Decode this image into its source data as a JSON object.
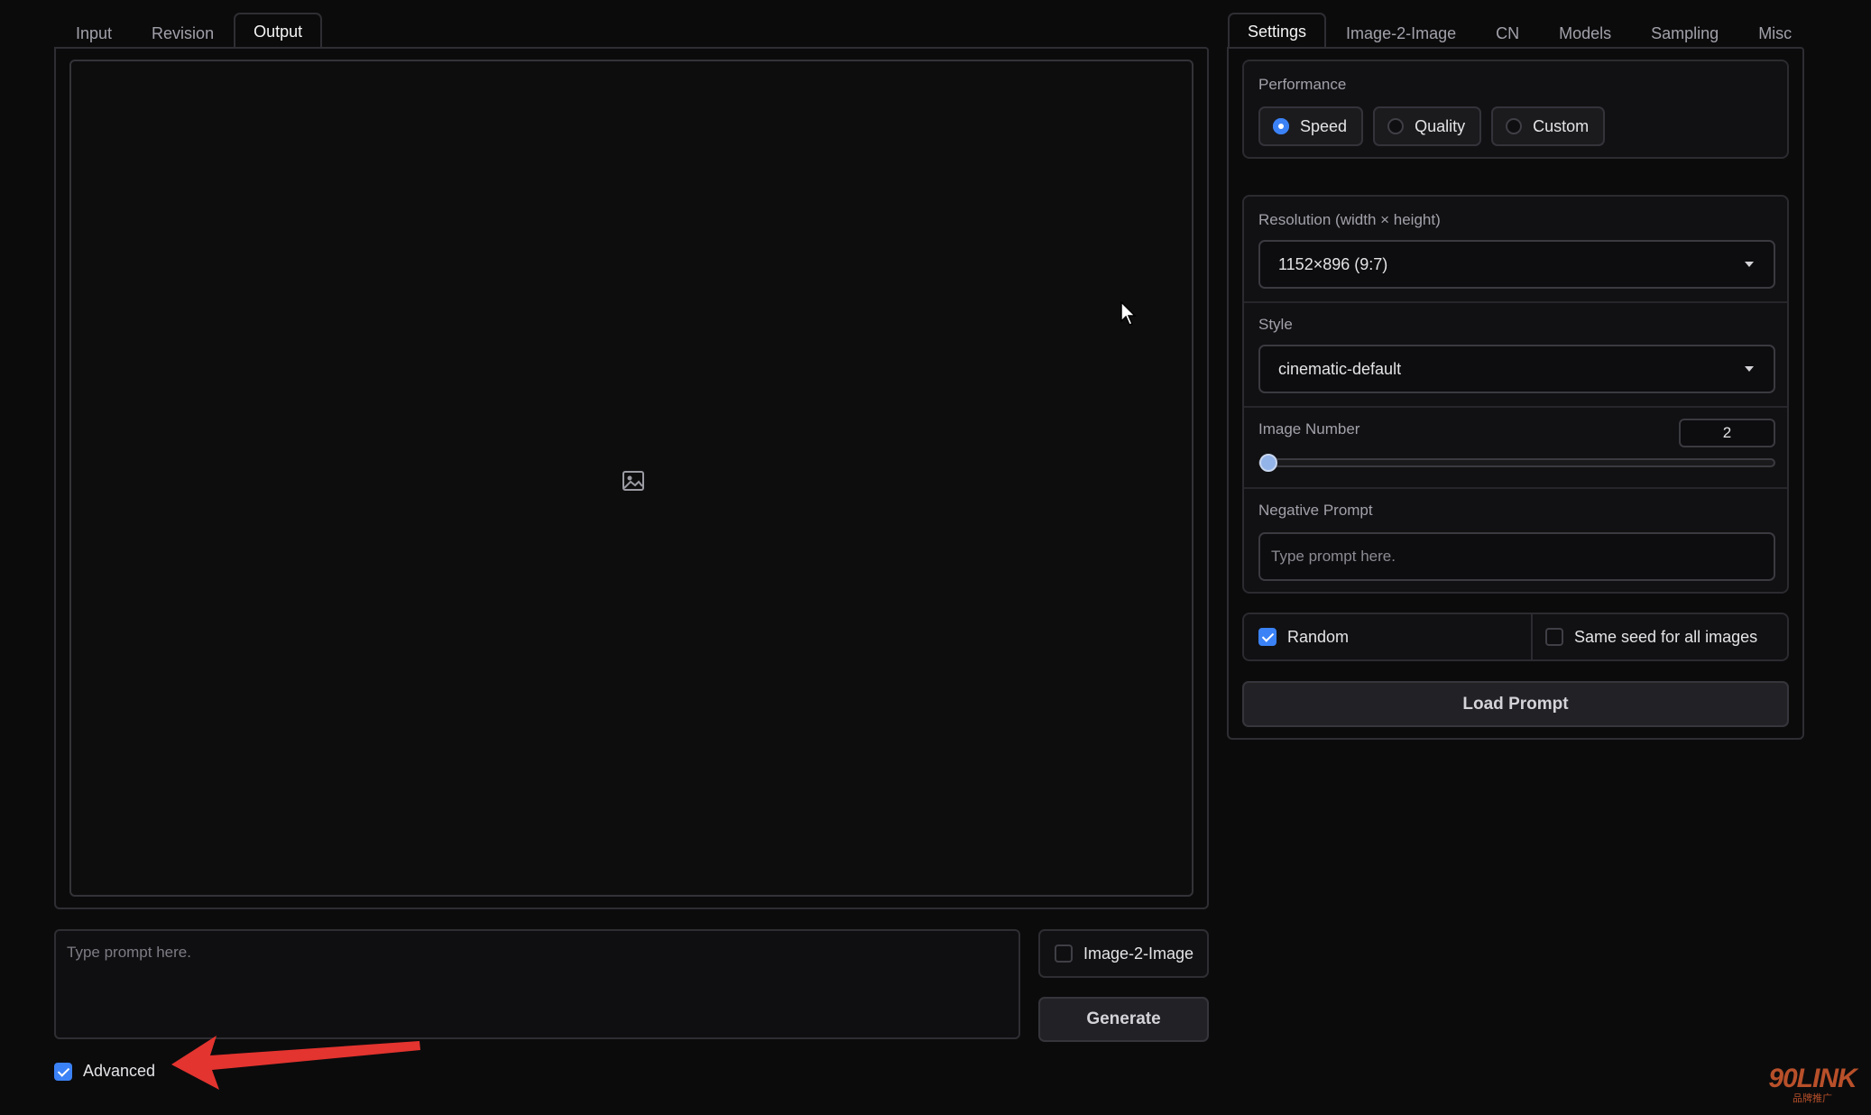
{
  "left_tabs": [
    {
      "label": "Input",
      "active": false
    },
    {
      "label": "Revision",
      "active": false
    },
    {
      "label": "Output",
      "active": true
    }
  ],
  "output": {
    "image_icon": "image-placeholder-icon"
  },
  "prompt": {
    "placeholder": "Type prompt here."
  },
  "image2image_toggle": {
    "label": "Image-2-Image",
    "checked": false
  },
  "generate_button": {
    "label": "Generate"
  },
  "advanced_toggle": {
    "label": "Advanced",
    "checked": true
  },
  "right_tabs": [
    {
      "label": "Settings",
      "active": true
    },
    {
      "label": "Image-2-Image",
      "active": false
    },
    {
      "label": "CN",
      "active": false
    },
    {
      "label": "Models",
      "active": false
    },
    {
      "label": "Sampling",
      "active": false
    },
    {
      "label": "Misc",
      "active": false
    }
  ],
  "settings": {
    "performance": {
      "label": "Performance",
      "options": [
        {
          "label": "Speed",
          "selected": true
        },
        {
          "label": "Quality",
          "selected": false
        },
        {
          "label": "Custom",
          "selected": false
        }
      ]
    },
    "resolution": {
      "label": "Resolution (width × height)",
      "value": "1152×896 (9:7)"
    },
    "style": {
      "label": "Style",
      "value": "cinematic-default"
    },
    "image_number": {
      "label": "Image Number",
      "value": "2"
    },
    "negative_prompt": {
      "label": "Negative Prompt",
      "placeholder": "Type prompt here."
    },
    "random": {
      "label": "Random",
      "checked": true
    },
    "same_seed": {
      "label": "Same seed for all images",
      "checked": false
    },
    "load_prompt": {
      "label": "Load Prompt"
    }
  },
  "watermark": {
    "text": "90LINK",
    "subtext": "品牌推广"
  },
  "colors": {
    "accent": "#3b82f6",
    "annotation_arrow": "#e3342f"
  }
}
